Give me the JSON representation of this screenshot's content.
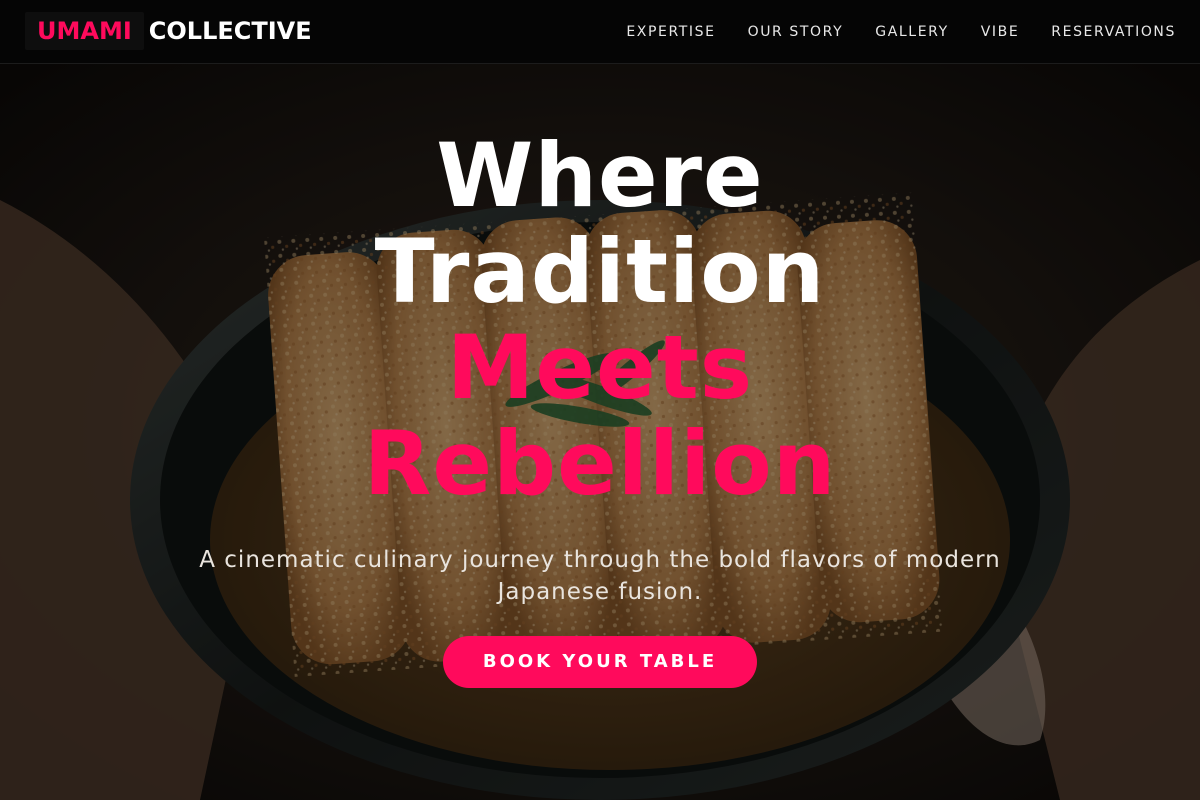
{
  "brand": {
    "accent": "UMAMI",
    "rest": "COLLECTIVE",
    "accent_color": "#ff0a5c"
  },
  "nav": {
    "items": [
      {
        "label": "EXPERTISE"
      },
      {
        "label": "OUR STORY"
      },
      {
        "label": "GALLERY"
      },
      {
        "label": "VIBE"
      },
      {
        "label": "RESERVATIONS"
      }
    ]
  },
  "hero": {
    "headline": {
      "line1": "Where",
      "line2": "Tradition",
      "line3": "Meets",
      "line4": "Rebellion"
    },
    "tagline": "A cinematic culinary journey through the bold flavors of modern Japanese fusion.",
    "cta_label": "BOOK YOUR TABLE"
  },
  "colors": {
    "accent": "#ff0a5c",
    "background": "#050505",
    "text": "#ffffff"
  }
}
